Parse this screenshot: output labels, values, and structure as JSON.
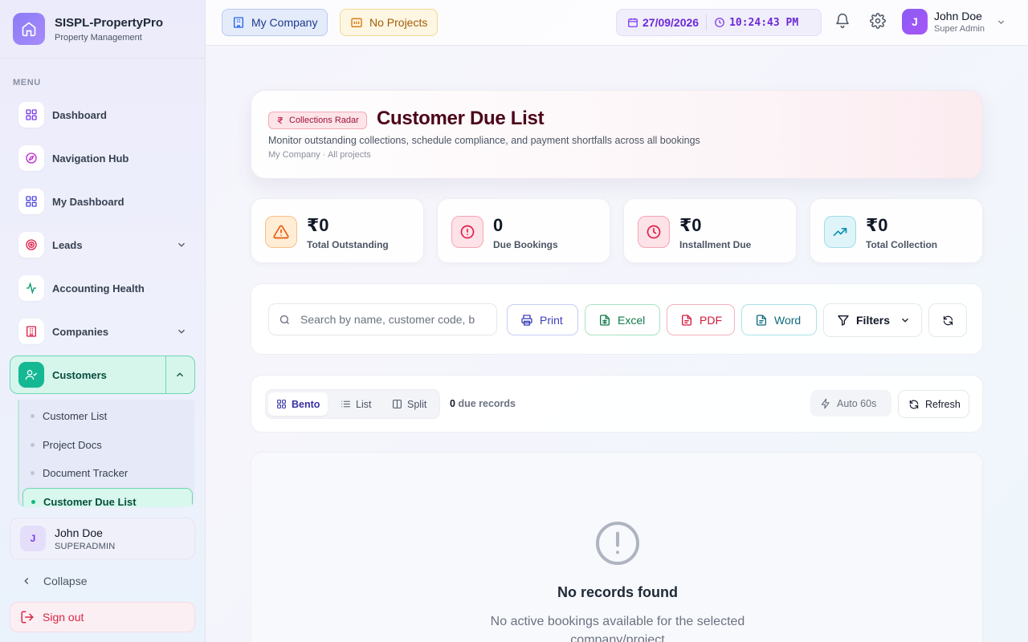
{
  "brand": {
    "name": "SISPL-PropertyPro",
    "subtitle": "Property Management"
  },
  "sidebar": {
    "menu_label": "MENU",
    "items": [
      {
        "label": "Dashboard",
        "icon": "grid-icon"
      },
      {
        "label": "Navigation Hub",
        "icon": "compass-icon"
      },
      {
        "label": "My Dashboard",
        "icon": "grid-icon"
      },
      {
        "label": "Leads",
        "icon": "target-icon"
      },
      {
        "label": "Accounting Health",
        "icon": "activity-icon"
      },
      {
        "label": "Companies",
        "icon": "building-icon"
      },
      {
        "label": "Customers",
        "icon": "user-check-icon"
      }
    ],
    "submenu": [
      "Customer List",
      "Project Docs",
      "Document Tracker",
      "Customer Due List"
    ],
    "user": {
      "initial": "J",
      "name": "John Doe",
      "role": "SUPERADMIN"
    },
    "collapse_label": "Collapse",
    "signout_label": "Sign out"
  },
  "topbar": {
    "company": "My Company",
    "projects": "No Projects",
    "date": "27/09/2026",
    "time": "10:24:43 PM",
    "user": {
      "initial": "J",
      "name": "John Doe",
      "role": "Super Admin"
    }
  },
  "hero": {
    "chip": "Collections Radar",
    "title": "Customer Due List",
    "description": "Monitor outstanding collections, schedule compliance, and payment shortfalls across all bookings",
    "meta": "My Company · All projects"
  },
  "stats": [
    {
      "value": "₹0",
      "label": "Total Outstanding",
      "icon": "alert-triangle-icon",
      "color": "#ea580c"
    },
    {
      "value": "0",
      "label": "Due Bookings",
      "icon": "alert-circle-icon",
      "color": "#e11d48"
    },
    {
      "value": "₹0",
      "label": "Installment Due",
      "icon": "clock-icon",
      "color": "#e11d48"
    },
    {
      "value": "₹0",
      "label": "Total Collection",
      "icon": "trending-up-icon",
      "color": "#0891b2"
    }
  ],
  "toolbar": {
    "search_placeholder": "Search by name, customer code, b",
    "print": "Print",
    "excel": "Excel",
    "pdf": "PDF",
    "word": "Word",
    "filters": "Filters"
  },
  "viewbar": {
    "views": [
      "Bento",
      "List",
      "Split"
    ],
    "record_count": "0",
    "record_suffix": "due records",
    "auto": "Auto 60s",
    "refresh": "Refresh"
  },
  "empty": {
    "title": "No records found",
    "description": "No active bookings available for the selected company/project"
  },
  "colors": {
    "accent": "#7c3aed",
    "active_green": "#14b892",
    "danger": "#dc2646"
  }
}
